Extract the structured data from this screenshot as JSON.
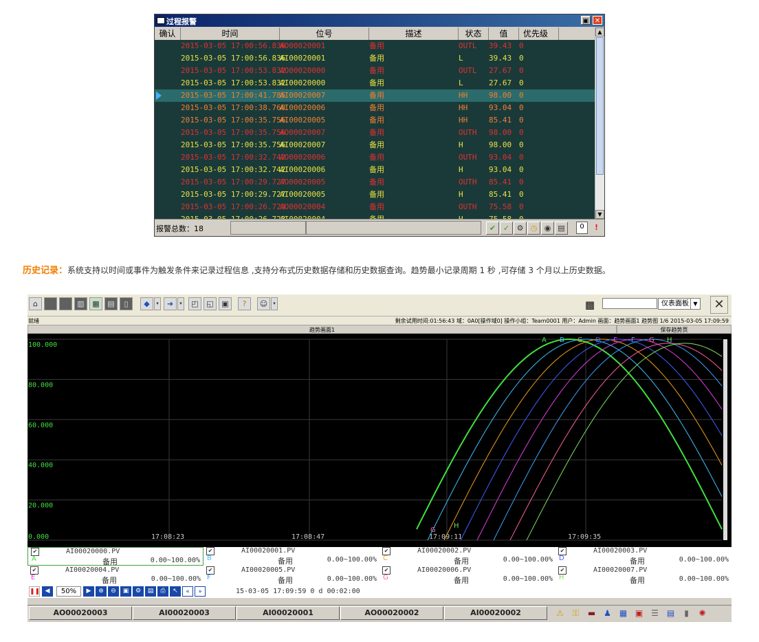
{
  "alarm": {
    "title": "过程报警",
    "restore_glyph": "▣",
    "close_glyph": "✕",
    "headers": {
      "ack": "确认",
      "time": "时间",
      "tag": "位号",
      "desc": "描述",
      "state": "状态",
      "value": "值",
      "priority": "优先级"
    },
    "rows": [
      {
        "time": "2015-03-05 17:00:56.836",
        "tag": "AO00020001",
        "desc": "备用",
        "state": "OUTL",
        "value": "39.43",
        "priority": "0",
        "color": "#e03030"
      },
      {
        "time": "2015-03-05 17:00:56.836",
        "tag": "AI00020001",
        "desc": "备用",
        "state": "L",
        "value": "39.43",
        "priority": "0",
        "color": "#e8e040"
      },
      {
        "time": "2015-03-05 17:00:53.832",
        "tag": "AO00020000",
        "desc": "备用",
        "state": "OUTL",
        "value": "27.67",
        "priority": "0",
        "color": "#e03030"
      },
      {
        "time": "2015-03-05 17:00:53.832",
        "tag": "AI00020000",
        "desc": "备用",
        "state": "L",
        "value": "27.67",
        "priority": "0",
        "color": "#e8e040"
      },
      {
        "time": "2015-03-05 17:00:41.785",
        "tag": "AI00020007",
        "desc": "备用",
        "state": "HH",
        "value": "98.00",
        "priority": "0",
        "color": "#f08030"
      },
      {
        "time": "2015-03-05 17:00:38.760",
        "tag": "AI00020006",
        "desc": "备用",
        "state": "HH",
        "value": "93.04",
        "priority": "0",
        "color": "#f08030"
      },
      {
        "time": "2015-03-05 17:00:35.756",
        "tag": "AI00020005",
        "desc": "备用",
        "state": "HH",
        "value": "85.41",
        "priority": "0",
        "color": "#f08030"
      },
      {
        "time": "2015-03-05 17:00:35.756",
        "tag": "AO00020007",
        "desc": "备用",
        "state": "OUTH",
        "value": "98.00",
        "priority": "0",
        "color": "#e03030"
      },
      {
        "time": "2015-03-05 17:00:35.756",
        "tag": "AI00020007",
        "desc": "备用",
        "state": "H",
        "value": "98.00",
        "priority": "0",
        "color": "#e8e040"
      },
      {
        "time": "2015-03-05 17:00:32.742",
        "tag": "AO00020006",
        "desc": "备用",
        "state": "OUTH",
        "value": "93.04",
        "priority": "0",
        "color": "#e03030"
      },
      {
        "time": "2015-03-05 17:00:32.742",
        "tag": "AI00020006",
        "desc": "备用",
        "state": "H",
        "value": "93.04",
        "priority": "0",
        "color": "#e8e040"
      },
      {
        "time": "2015-03-05 17:00:29.727",
        "tag": "AO00020005",
        "desc": "备用",
        "state": "OUTH",
        "value": "85.41",
        "priority": "0",
        "color": "#e03030"
      },
      {
        "time": "2015-03-05 17:00:29.727",
        "tag": "AI00020005",
        "desc": "备用",
        "state": "H",
        "value": "85.41",
        "priority": "0",
        "color": "#e8e040"
      },
      {
        "time": "2015-03-05 17:00:26.723",
        "tag": "AO00020004",
        "desc": "备用",
        "state": "OUTH",
        "value": "75.58",
        "priority": "0",
        "color": "#e03030"
      },
      {
        "time": "2015-03-05 17:00:26.723",
        "tag": "AI00020004",
        "desc": "备用",
        "state": "H",
        "value": "75.58",
        "priority": "0",
        "color": "#e8e040"
      }
    ],
    "selected_row": 4,
    "total_label": "报警总数：18",
    "footer_count": "0",
    "footer_icons": [
      "check-icon",
      "check-all-icon",
      "gear-icon",
      "clock-icon",
      "eye-icon",
      "print-icon",
      "alert-icon"
    ]
  },
  "caption": {
    "title": "历史记录：",
    "text": "系统支持以时间或事件为触发条件来记录过程信息 ,支持分布式历史数据存储和历史数据查询。趋势最小记录周期 1 秒 ,可存储 3 个月以上历史数据。"
  },
  "trend": {
    "panel_select": "仪表面板",
    "status_left": "就绪",
    "status_right": "剩余试用时间:01:56:43 域：0A0[操作域0] 操作小组：Team0001 用户：Admin 画面：趋势画面1 趋势图 1/6  2015-03-05 17:09:59",
    "pane_title": "趋势画面1",
    "pane_save": "保存趋势页",
    "legend": [
      {
        "letter": "A",
        "tag": "AI00020000.PV",
        "desc": "备用",
        "range": "0.00~100.00%",
        "color": "#40e040"
      },
      {
        "letter": "B",
        "tag": "AI00020001.PV",
        "desc": "备用",
        "range": "0.00~100.00%",
        "color": "#40c0ff"
      },
      {
        "letter": "C",
        "tag": "AI00020002.PV",
        "desc": "备用",
        "range": "0.00~100.00%",
        "color": "#f0a020"
      },
      {
        "letter": "D",
        "tag": "AI00020003.PV",
        "desc": "备用",
        "range": "0.00~100.00%",
        "color": "#4060ff"
      },
      {
        "letter": "E",
        "tag": "AI00020004.PV",
        "desc": "备用",
        "range": "0.00~100.00%",
        "color": "#e040e0"
      },
      {
        "letter": "F",
        "tag": "AI00020005.PV",
        "desc": "备用",
        "range": "0.00~100.00%",
        "color": "#40a0ff"
      },
      {
        "letter": "G",
        "tag": "AI00020006.PV",
        "desc": "备用",
        "range": "0.00~100.00%",
        "color": "#ff60a0"
      },
      {
        "letter": "H",
        "tag": "AI00020007.PV",
        "desc": "备用",
        "range": "0.00~100.00%",
        "color": "#80e060"
      }
    ],
    "zoom": "50%",
    "time_readout": "15-03-05 17:09:59   0 d 00:02:00",
    "tag_buttons": [
      "AO00020003",
      "AI00020003",
      "AI00020001",
      "AO00020002",
      "AI00020002"
    ]
  },
  "chart_data": {
    "type": "line",
    "title": "",
    "xlabel": "",
    "ylabel": "",
    "ylim": [
      0,
      100
    ],
    "y_ticks": [
      "100.000",
      "80.000",
      "60.000",
      "40.000",
      "20.000",
      "0.000"
    ],
    "x_ticks": [
      "17:08:23",
      "17:08:47",
      "17:09:11",
      "17:09:35"
    ],
    "grid": true,
    "series": [
      {
        "label": "A",
        "color": "#40e040"
      },
      {
        "label": "B",
        "color": "#40c0ff"
      },
      {
        "label": "C",
        "color": "#f0a020"
      },
      {
        "label": "D",
        "color": "#4060ff"
      },
      {
        "label": "E",
        "color": "#e040e0"
      },
      {
        "label": "F",
        "color": "#40a0ff"
      },
      {
        "label": "G",
        "color": "#ff60a0"
      },
      {
        "label": "H",
        "color": "#80e060"
      }
    ],
    "peak_values": [
      100,
      100,
      100,
      100,
      100,
      100,
      98,
      98
    ]
  }
}
